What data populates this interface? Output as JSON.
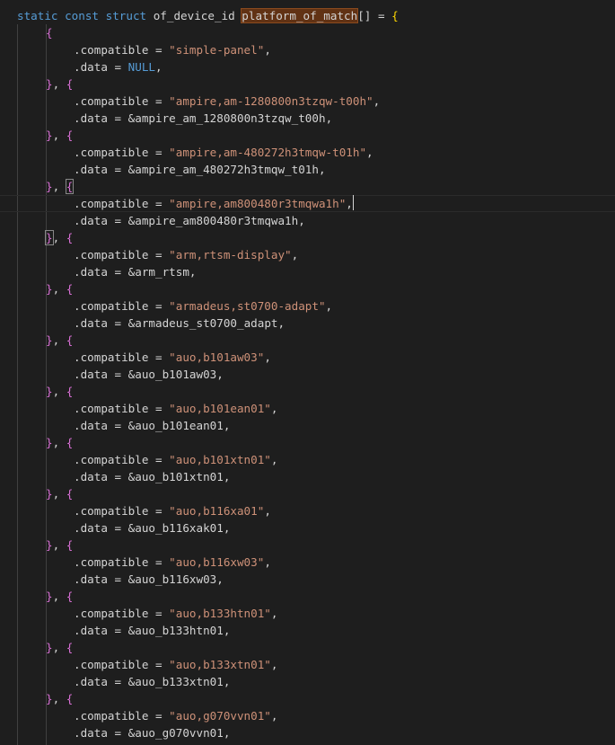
{
  "header": {
    "kw_static": "static",
    "kw_const": "const",
    "kw_struct": "struct",
    "type": "of_device_id",
    "name": "platform_of_match",
    "suffix": "[] = ",
    "open": "{"
  },
  "open_brace": "{",
  "sep_close": "}",
  "sep_comma": ", ",
  "sep_open": "{",
  "prop_compatible": ".compatible = ",
  "prop_data": ".data = ",
  "null_value": "NULL",
  "entries": [
    {
      "compatible": "\"simple-panel\"",
      "data": "NULL"
    },
    {
      "compatible": "\"ampire,am-1280800n3tzqw-t00h\"",
      "data": "&ampire_am_1280800n3tzqw_t00h"
    },
    {
      "compatible": "\"ampire,am-480272h3tmqw-t01h\"",
      "data": "&ampire_am_480272h3tmqw_t01h"
    },
    {
      "compatible": "\"ampire,am800480r3tmqwa1h\"",
      "data": "&ampire_am800480r3tmqwa1h"
    },
    {
      "compatible": "\"arm,rtsm-display\"",
      "data": "&arm_rtsm"
    },
    {
      "compatible": "\"armadeus,st0700-adapt\"",
      "data": "&armadeus_st0700_adapt"
    },
    {
      "compatible": "\"auo,b101aw03\"",
      "data": "&auo_b101aw03"
    },
    {
      "compatible": "\"auo,b101ean01\"",
      "data": "&auo_b101ean01"
    },
    {
      "compatible": "\"auo,b101xtn01\"",
      "data": "&auo_b101xtn01"
    },
    {
      "compatible": "\"auo,b116xa01\"",
      "data": "&auo_b116xak01"
    },
    {
      "compatible": "\"auo,b116xw03\"",
      "data": "&auo_b116xw03"
    },
    {
      "compatible": "\"auo,b133htn01\"",
      "data": "&auo_b133htn01"
    },
    {
      "compatible": "\"auo,b133xtn01\"",
      "data": "&auo_b133xtn01"
    },
    {
      "compatible": "\"auo,g070vvn01\"",
      "data": "&auo_g070vvn01"
    }
  ],
  "colors": {
    "background": "#1e1e1e",
    "keyword": "#569cd6",
    "string": "#ce9178",
    "bracket_level1": "#ffd700",
    "bracket_level2": "#da70d6",
    "selection_highlight": "#613214"
  }
}
